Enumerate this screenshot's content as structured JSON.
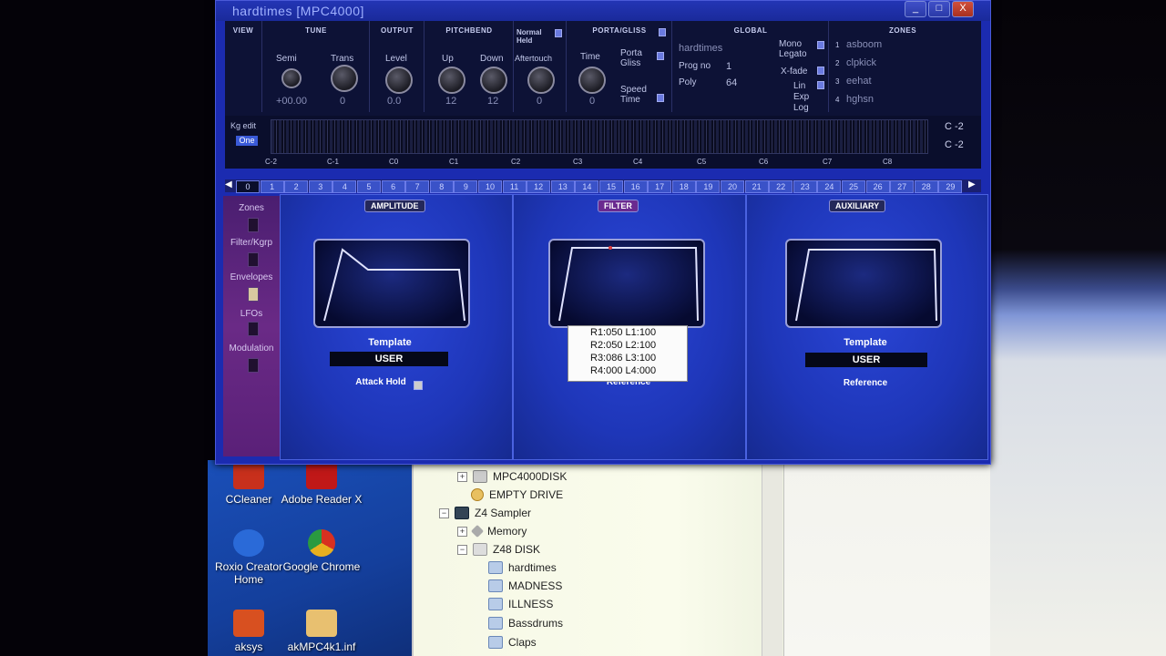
{
  "window": {
    "title": "hardtimes [MPC4000]",
    "min": "_",
    "max": "□",
    "close": "X"
  },
  "top": {
    "view": "VIEW",
    "tune": {
      "head": "TUNE",
      "semi": "Semi",
      "trans": "Trans",
      "semi_val": "+00.00",
      "trans_val": "0"
    },
    "output": {
      "head": "OUTPUT",
      "level": "Level",
      "level_val": "0.0"
    },
    "pitchbend": {
      "head": "PITCHBEND",
      "up": "Up",
      "down": "Down",
      "up_val": "12",
      "down_val": "12"
    },
    "normal_held": {
      "head": "Normal Held",
      "aftertouch": "Aftertouch",
      "after_val": "0"
    },
    "porta": {
      "head": "PORTA/GLISS",
      "time": "Time",
      "time_val": "0",
      "porta_gliss": "Porta Gliss",
      "speed_time": "Speed Time"
    },
    "global": {
      "head": "GLOBAL",
      "name": "hardtimes",
      "prog_label": "Prog no",
      "prog_val": "1",
      "poly_label": "Poly",
      "poly_val": "64",
      "mono": "Mono Legato",
      "xfade": "X-fade",
      "lin": "Lin",
      "exp": "Exp",
      "log": "Log"
    },
    "zones": {
      "head": "ZONES",
      "items": [
        {
          "n": "1",
          "name": "asboom"
        },
        {
          "n": "2",
          "name": "clpkick"
        },
        {
          "n": "3",
          "name": "eehat"
        },
        {
          "n": "4",
          "name": "hghsn"
        }
      ]
    }
  },
  "keyboard": {
    "kg_edit": "Kg edit",
    "one": "One",
    "octaves": [
      "C-2",
      "C-1",
      "C0",
      "C1",
      "C2",
      "C3",
      "C4",
      "C5",
      "C6",
      "C7",
      "C8"
    ],
    "range1": "C -2",
    "range2": "C -2"
  },
  "numbers": [
    "0",
    "1",
    "2",
    "3",
    "4",
    "5",
    "6",
    "7",
    "8",
    "9",
    "10",
    "11",
    "12",
    "13",
    "14",
    "15",
    "16",
    "17",
    "18",
    "19",
    "20",
    "21",
    "22",
    "23",
    "24",
    "25",
    "26",
    "27",
    "28",
    "29"
  ],
  "sidebar": [
    "Zones",
    "Filter/Kgrp",
    "Envelopes",
    "LFOs",
    "Modulation"
  ],
  "amplitude": {
    "tab": "AMPLITUDE",
    "template": "Template",
    "user": "USER",
    "attack_hold": "Attack Hold"
  },
  "filter": {
    "tab": "FILTER",
    "reference": "Reference",
    "popup": [
      "R1:050 L1:100",
      "R2:050 L2:100",
      "R3:086 L3:100",
      "R4:000 L4:000"
    ]
  },
  "auxiliary": {
    "tab": "AUXILIARY",
    "template": "Template",
    "user": "USER",
    "reference": "Reference"
  },
  "desktop": [
    {
      "label": "CCleaner",
      "color": "#c8301c"
    },
    {
      "label": "Adobe Reader X",
      "color": "#c01818"
    },
    {
      "label": "Roxio Creator Home",
      "color": "#2a6ad8"
    },
    {
      "label": "Google Chrome",
      "color": "#e8b020"
    },
    {
      "label": "aksys",
      "color": "#d85020"
    },
    {
      "label": "akMPC4k1.inf",
      "color": "#e8c070"
    }
  ],
  "tree": [
    {
      "label": "MPC4000DISK",
      "indent": 1,
      "exp": "+"
    },
    {
      "label": "EMPTY DRIVE",
      "indent": 1,
      "exp": ""
    },
    {
      "label": "Z4 Sampler",
      "indent": 0,
      "exp": "−"
    },
    {
      "label": "Memory",
      "indent": 1,
      "exp": "+"
    },
    {
      "label": "Z48 DISK",
      "indent": 1,
      "exp": "−"
    },
    {
      "label": "hardtimes",
      "indent": 2,
      "exp": ""
    },
    {
      "label": "MADNESS",
      "indent": 2,
      "exp": ""
    },
    {
      "label": "ILLNESS",
      "indent": 2,
      "exp": ""
    },
    {
      "label": "Bassdrums",
      "indent": 2,
      "exp": ""
    },
    {
      "label": "Claps",
      "indent": 2,
      "exp": ""
    }
  ]
}
